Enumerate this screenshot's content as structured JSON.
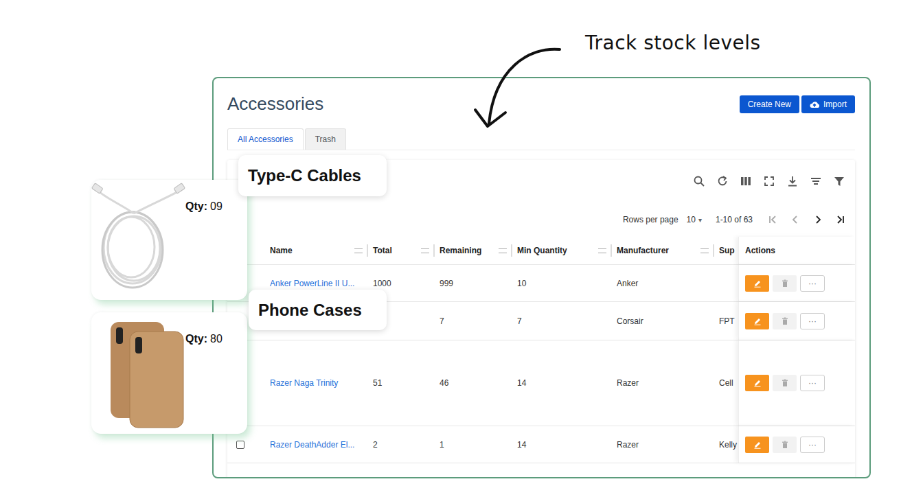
{
  "annotation": {
    "text": "Track stock levels"
  },
  "page": {
    "title": "Accessories"
  },
  "buttons": [
    {
      "label": "Create New"
    },
    {
      "label": "Import"
    }
  ],
  "tabs": [
    {
      "label": "All Accessories",
      "selected": true
    },
    {
      "label": "Trash",
      "selected": false
    }
  ],
  "pagination": {
    "rows_per_page_label": "Rows per page",
    "rows_per_page": "10",
    "dropdown_glyph": "▾",
    "range": "1-10 of 63",
    "nav": [
      {
        "disabled": true
      },
      {
        "disabled": true
      },
      {
        "disabled": false
      },
      {
        "disabled": false
      }
    ]
  },
  "table": {
    "columns": [
      "Name",
      "Total",
      "Remaining",
      "Min Quantity",
      "Manufacturer",
      "Sup",
      "Actions"
    ],
    "more_glyph": "···",
    "rows": [
      {
        "checked": false,
        "cells": [
          "Anker PowerLine II U...",
          "1000",
          "999",
          "10",
          "Anker",
          ""
        ]
      },
      {
        "checked": false,
        "cells": [
          "",
          "",
          "7",
          "7",
          "Corsair",
          "FPT"
        ]
      },
      {
        "checked": false,
        "cells": [
          "Razer Naga Trinity",
          "51",
          "46",
          "14",
          "Razer",
          "Cell"
        ]
      },
      {
        "checked": false,
        "cells": [
          "Razer DeathAdder El...",
          "2",
          "1",
          "14",
          "Razer",
          "Kelly"
        ]
      }
    ]
  },
  "callouts": [
    {
      "title": "Type-C Cables",
      "qty_label": "Qty:",
      "qty": "09"
    },
    {
      "title": "Phone Cases",
      "qty_label": "Qty:",
      "qty": "80"
    }
  ]
}
